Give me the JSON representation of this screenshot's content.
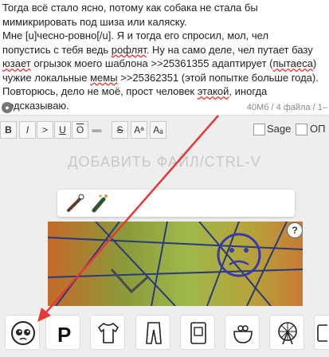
{
  "post_text": {
    "line1": "Тогда всё стало ясно, потому как собака не стала бы",
    "line2": "мимикрировать под шиза или каляску.",
    "line3_a": "Мне [u]чесно-ровно[/u]. Я и тогда его спросил, мол, чел",
    "line4_a": "попустись с тебя ведь",
    "line4_b": "рофлят",
    "line4_c": ". Ну на само деле, чел путает базу",
    "line5_a": "юзает",
    "line5_b": " огрызок моего шаблона >>25361355 адаптирует (",
    "line5_c": "пытаеса",
    "line5_d": ")",
    "line6_a": "чужие локальные ",
    "line6_b": "мемы",
    "line6_c": " >>25362351 (этой попытке больше года).",
    "line7_a": "Повторюсь, дело не моё, прост человек ",
    "line7_b": "этакой",
    "line7_c": ", иногда",
    "line8": "подсказываю."
  },
  "counter": "40Мб / 4 файла / 1–",
  "toolbar": {
    "bold": "B",
    "italic": "I",
    "quote": ">",
    "underline": "U",
    "overline": "O",
    "strike": "S",
    "sup": "Aᵃ",
    "sub": "Aₐ",
    "sage_label": "Sage",
    "op_label": "ОП"
  },
  "add_file": "ДОБАВИТЬ ФАЙЛ/CTRL-V",
  "help": "?",
  "emoji_icons": [
    "pleading-face-icon",
    "parking-icon",
    "shirt-icon",
    "trousers-icon",
    "passport-icon",
    "purse-icon",
    "ferris-wheel-icon",
    "bus-icon"
  ],
  "colors": {
    "arrow": "#e53935",
    "panel": "#eeeeee",
    "text": "#222222"
  }
}
